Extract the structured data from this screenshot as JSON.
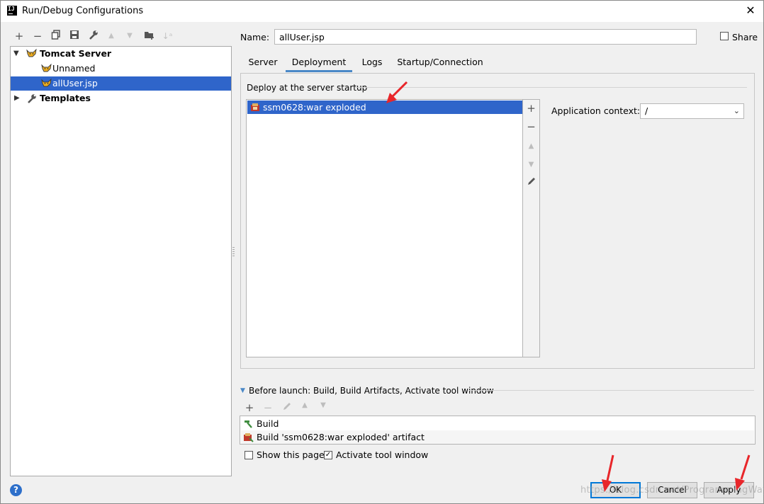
{
  "window": {
    "title": "Run/Debug Configurations",
    "app_icon_text": "IJ"
  },
  "tree": {
    "items": [
      {
        "label": "Tomcat Server",
        "bold": true
      },
      {
        "label": "Unnamed"
      },
      {
        "label": "allUser.jsp",
        "selected": true
      },
      {
        "label": "Templates",
        "bold": true
      }
    ]
  },
  "name": {
    "label": "Name:",
    "value": "allUser.jsp"
  },
  "share": {
    "label": "Share",
    "checked": false
  },
  "tabs": [
    {
      "label": "Server"
    },
    {
      "label": "Deployment",
      "active": true
    },
    {
      "label": "Logs"
    },
    {
      "label": "Startup/Connection"
    }
  ],
  "deployment": {
    "section_label": "Deploy at the server startup",
    "artifacts": [
      "ssm0628:war exploded"
    ],
    "context_label": "Application context:",
    "context_value": "/"
  },
  "before_launch": {
    "label": "Before launch: Build, Build Artifacts, Activate tool window",
    "tasks": [
      "Build",
      "Build 'ssm0628:war exploded' artifact"
    ]
  },
  "options": {
    "show_page": {
      "label": "Show this page",
      "checked": false
    },
    "activate_tool_window": {
      "label": "Activate tool window",
      "checked": true
    }
  },
  "buttons": {
    "ok": "OK",
    "cancel": "Cancel",
    "apply": "Apply"
  },
  "watermark": "https://blog.csdn.net/ProgrammingWay",
  "colors": {
    "selection": "#2f65ca",
    "accent": "#4a88c7",
    "annotation": "#e8262a"
  }
}
